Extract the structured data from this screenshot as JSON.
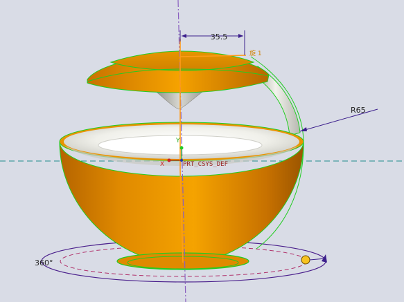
{
  "viewport": {
    "background": "#d9dce6",
    "model_color": "#f09a00",
    "inner_color": "#f3f3ee",
    "edge_color": "#22cc22",
    "dimension_color": "#3c1f8c",
    "centerline_color": "#1f8c8c",
    "axis_color": "#8a5fc0"
  },
  "dimensions": {
    "width": "35.5",
    "radius": "R65",
    "revolve_angle": "360°"
  },
  "csys": {
    "label": "PRT_CSYS_DEF",
    "x_label": "X",
    "y_label": "Y"
  },
  "annotation": {
    "label": "旋 1"
  }
}
